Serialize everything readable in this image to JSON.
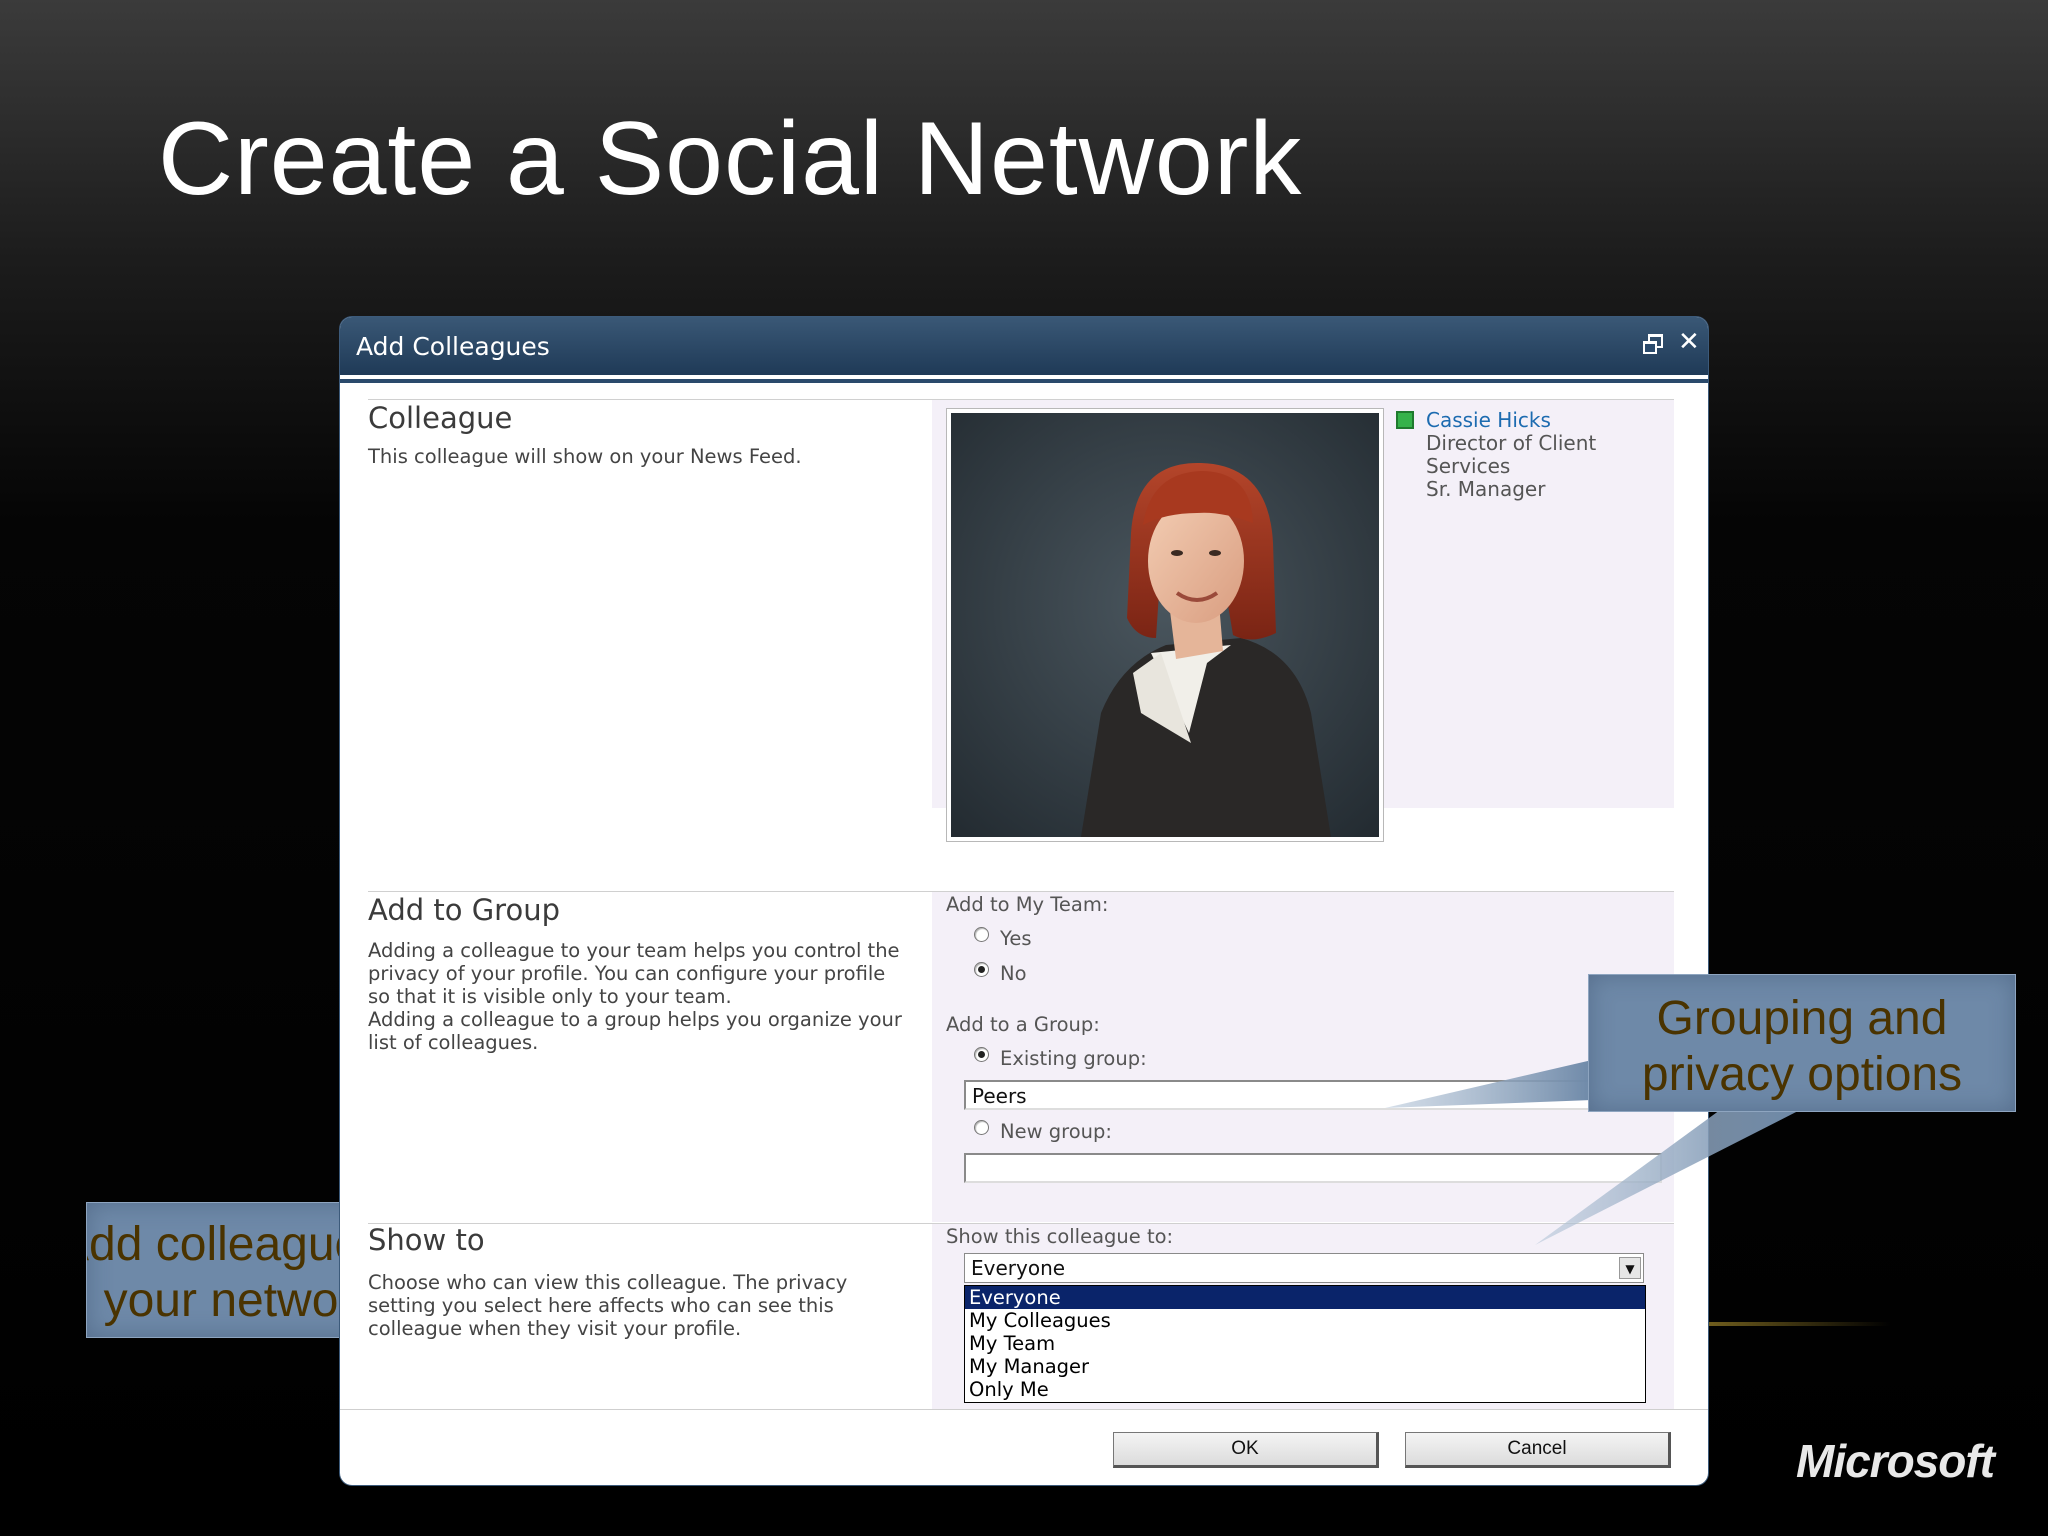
{
  "slide": {
    "title": "Create a Social Network",
    "callout_left_line1": "Add colleagues to",
    "callout_left_line2": "your network",
    "callout_right_line1": "Grouping and",
    "callout_right_line2": "privacy options",
    "logo": "Microsoft"
  },
  "dialog": {
    "title": "Add Colleagues",
    "colleague": {
      "heading": "Colleague",
      "description": "This colleague will show on your News Feed.",
      "name": "Cassie Hicks",
      "title_line1": "Director of Client",
      "title_line2": "Services",
      "title_line3": "Sr. Manager"
    },
    "group": {
      "heading": "Add to Group",
      "desc_line1": "Adding a colleague to your team helps you control the",
      "desc_line2": "privacy of your profile. You can configure your profile",
      "desc_line3": "so that it is visible only to your team.",
      "desc_line4": "Adding a colleague to a group helps you organize your",
      "desc_line5": "list of colleagues.",
      "team_label": "Add to My Team:",
      "yes": "Yes",
      "no": "No",
      "team_selected": "No",
      "group_label": "Add to a Group:",
      "existing": "Existing group:",
      "existing_value": "Peers",
      "new": "New group:",
      "new_value": ""
    },
    "show": {
      "heading": "Show to",
      "desc_line1": "Choose who can view this colleague. The privacy",
      "desc_line2": "setting you select here affects who can see this",
      "desc_line3": "colleague when they visit your profile.",
      "label": "Show this colleague to:",
      "value": "Everyone",
      "options": [
        "Everyone",
        "My Colleagues",
        "My Team",
        "My Manager",
        "Only Me"
      ]
    },
    "ok": "OK",
    "cancel": "Cancel"
  }
}
